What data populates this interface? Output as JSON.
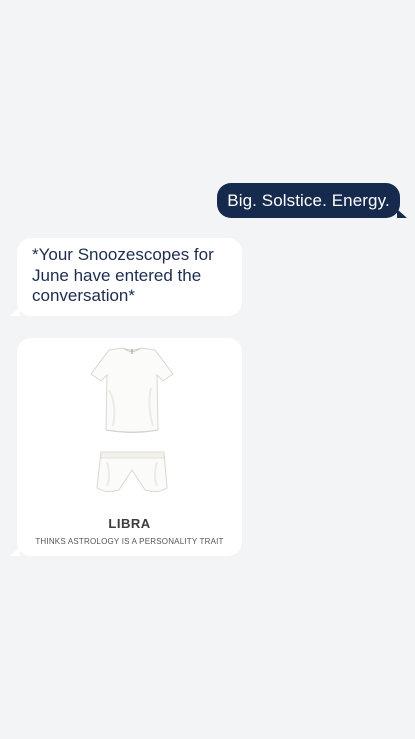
{
  "messages": {
    "outgoing_text": "Big. Solstice. Energy.",
    "incoming_text": "*Your Snoozescopes for June have entered the conversation*"
  },
  "card": {
    "image": "pajama-set-shirt-and-shorts",
    "sign": "LIBRA",
    "trait": "THINKS ASTROLOGY IS A PERSONALITY TRAIT"
  },
  "colors": {
    "background": "#f3f4f6",
    "outgoing_bubble": "#152a4c",
    "incoming_bubble": "#ffffff",
    "incoming_text": "#1c2d4f"
  }
}
